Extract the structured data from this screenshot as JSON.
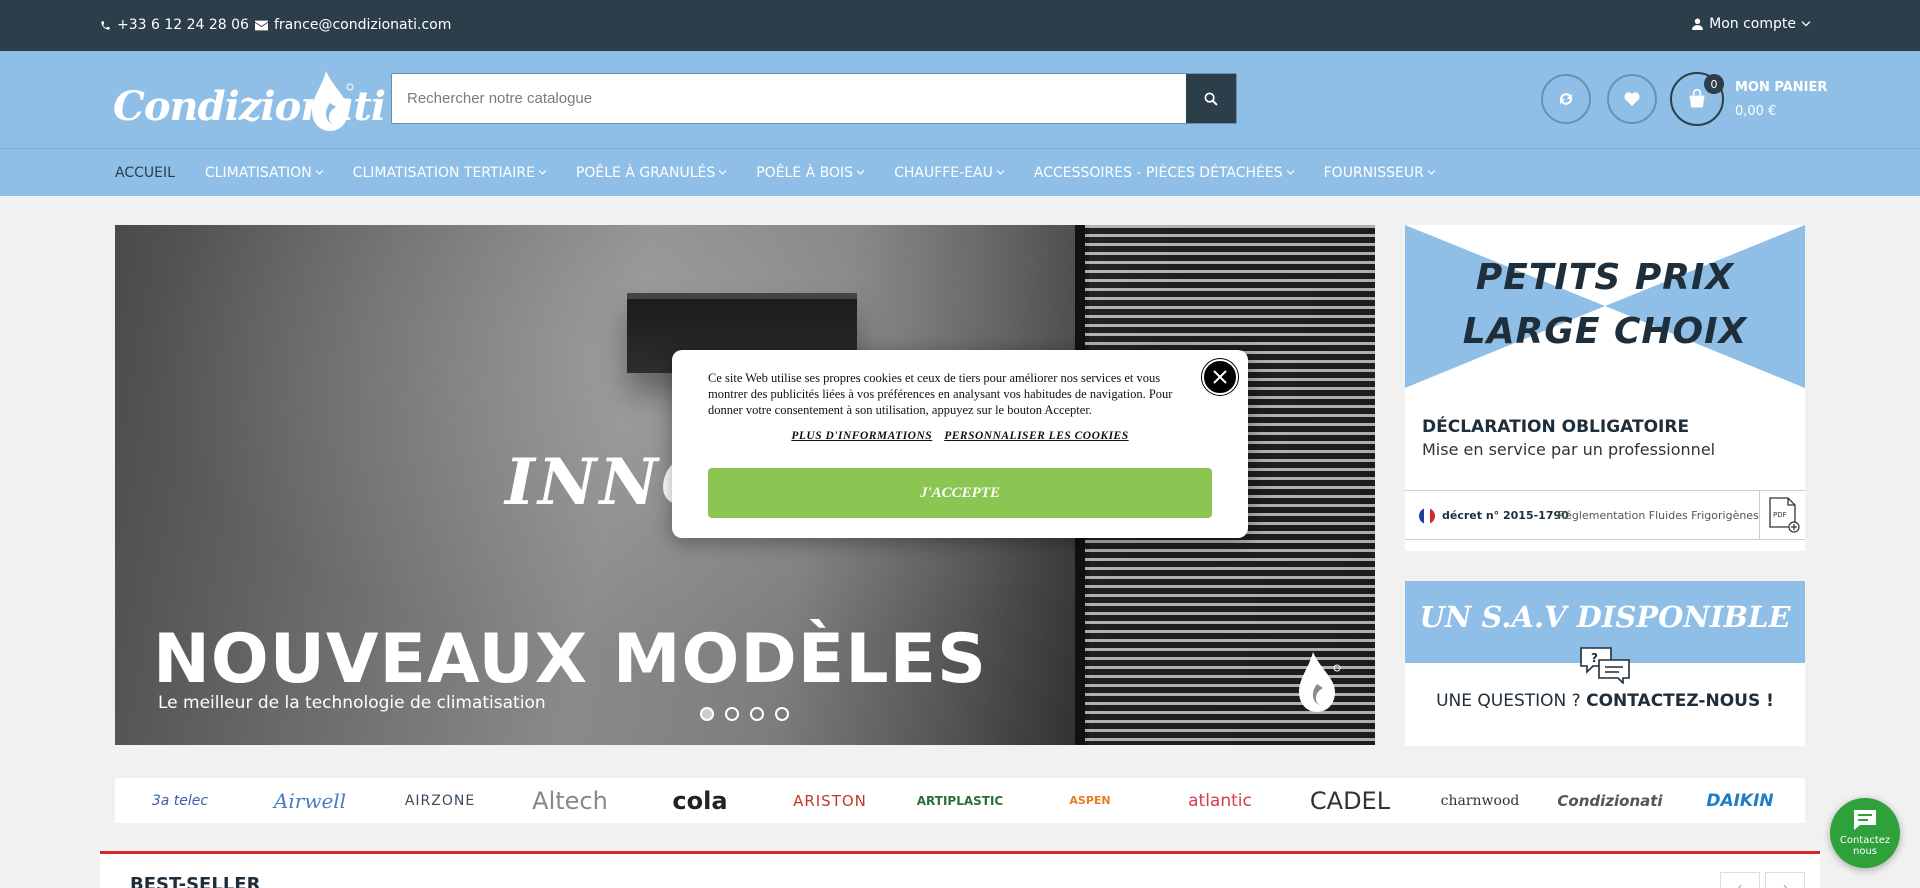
{
  "topbar": {
    "phone": "+33 6 12 24 28 06",
    "email": "france@condizionati.com",
    "account_label": "Mon compte"
  },
  "header": {
    "logo_text": "Condizionati",
    "search": {
      "placeholder": "Rechercher notre catalogue",
      "value": ""
    },
    "cart": {
      "count": "0",
      "label": "MON PANIER",
      "amount": "0,00 €"
    }
  },
  "nav": {
    "items": [
      {
        "label": "ACCUEIL",
        "active": true
      },
      {
        "label": "CLIMATISATION"
      },
      {
        "label": "CLIMATISATION TERTIAIRE"
      },
      {
        "label": "POÊLE À GRANULÉS"
      },
      {
        "label": "POÊLE À BOIS"
      },
      {
        "label": "CHAUFFE-EAU"
      },
      {
        "label": "ACCESSOIRES - PIÈCES DÉTACHÉES"
      },
      {
        "label": "FOURNISSEUR"
      }
    ]
  },
  "slider": {
    "overlay_text": "INNO",
    "headline": "NOUVEAUX MODÈLES",
    "subtitle": "Le meilleur de la technologie de climatisation",
    "slide_count": 4,
    "active_slide": 1
  },
  "banner_promo": {
    "line1": "PETITS PRIX",
    "line2": "LARGE CHOIX",
    "declaration_title": "DÉCLARATION OBLIGATOIRE",
    "declaration_sub": "Mise en service par un professionnel",
    "decree": "décret n° 2015-1790",
    "regulation": "Réglementation Fluides Frigorigènes",
    "pdf_label": "PDF"
  },
  "banner_sav": {
    "title": "UN S.A.V DISPONIBLE",
    "question": "UNE QUESTION ?",
    "cta": "CONTACTEZ-NOUS !"
  },
  "brands": [
    "3a telec",
    "Airwell",
    "AIRZONE",
    "Altech",
    "cola",
    "ARISTON",
    "ARTIPLASTIC",
    "ASPEN",
    "atlantic",
    "CADEL",
    "charnwood",
    "Condizionati",
    "DAIKIN"
  ],
  "bestseller": {
    "title": "BEST-SELLER"
  },
  "chat": {
    "line1": "Contactez",
    "line2": "nous"
  },
  "cookie": {
    "message": "Ce site Web utilise ses propres cookies et ceux de tiers pour améliorer nos services et vous montrer des publicités liées à vos préférences en analysant vos habitudes de navigation. Pour donner votre consentement à son utilisation, appuyez sur le bouton Accepter.",
    "more_info": "PLUS D'INFORMATIONS",
    "customize": "PERSONNALISER LES COOKIES",
    "accept": "J'ACCEPTE"
  },
  "colors": {
    "topbar": "#2b3e4a",
    "header": "#8fbfe6",
    "accept_green": "#8bc653",
    "accent_red": "#d62828",
    "chat_green": "#2fa13a"
  }
}
